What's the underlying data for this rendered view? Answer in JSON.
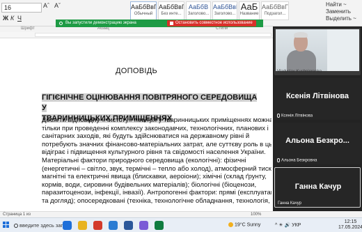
{
  "ribbon": {
    "font_name": "",
    "font_size": "16",
    "format_buttons": [
      "Aˆ",
      "Aˇ"
    ],
    "bottom_labels": [
      "Ж",
      "К",
      "Ч"
    ],
    "styles": [
      {
        "sample": "АаБбВвГг,",
        "name": "Обычный"
      },
      {
        "sample": "АаБбВвГг,",
        "name": "Без инте..."
      },
      {
        "sample": "АаБбВ",
        "name": "Заголово..."
      },
      {
        "sample": "АаБбВвГ",
        "name": "Заголово..."
      },
      {
        "sample": "АаБ",
        "name": "Название"
      },
      {
        "sample": "АаБбВвГг",
        "name": "Подзагол..."
      }
    ],
    "right_items": [
      "Найти ~",
      "Заменить",
      "Выделить ~"
    ],
    "group_labels": [
      "Шрифт",
      "Абзац",
      "Стили"
    ]
  },
  "banner": {
    "demo_text": "Вы запустили демонстрацию экрана",
    "stop_text": "Остановить совместное использование",
    "color": "#1e9b45",
    "stop_color": "#d9302a"
  },
  "document": {
    "title": "ДОПОВІДЬ",
    "heading": [
      "ГІГІЄНІЧНЕ ОЦІНЮВАННЯ ПОВІТРЯНОГО СЕРЕДОВИЩА У",
      "ТВАРИННИЦЬКИХ ПРИМІЩЕННЯХ"
    ],
    "lines": [
      "Досягти відповідну «чистоту» повітря у тваринницьких приміщеннях можна",
      "тільки при проведенні комплексу законодавчих, технологічних, планових і",
      "санітарних заходів, які будуть здійснюватися на державному рівні й",
      "потребують значних фінансово-матеріальних затрат, але суттєву роль в цьому",
      "відіграє і підвищення культурного рівня та свідомості населення України.",
      "Матеріальні фактори природного середовища (екологічні): фізичні",
      "(енергетичні – світло, звук, термічні – тепло або холод), атмосферний тиск,",
      "магнітні та електричні явища (блискавки, аероіони); хімічні (склад ґрунту,",
      "кормів, води, сировини будівельних матеріалів); біологічні (біоценози,",
      "паразитоценози, інфекції, інвазії). Антропогенні фактори: прямі (експлуатація",
      "та догляд); опосередковані (техніка, технологічне обладнання, технологія,"
    ]
  },
  "status": {
    "left": "Страница 1 из",
    "zoom": "100%"
  },
  "participants": [
    {
      "name_big": "",
      "label": "Vladyslav Kushnierenko",
      "video": true
    },
    {
      "name_big": "Ксенія Літвінова",
      "label": "Ксенія Літвінова",
      "video": false
    },
    {
      "name_big": "Альона Безкро...",
      "label": "Альона Безкровна",
      "video": false
    },
    {
      "name_big": "Ганна Качур",
      "label": "Ганна Качур",
      "video": false
    }
  ],
  "taskbar": {
    "search_text": "ввeдите здесь запрос",
    "weather": "19°C  Sunny",
    "lang": "УКР",
    "time": "12:15",
    "date": "17.05.2024",
    "icon_colors": [
      "#1e6fd9",
      "#e8b321",
      "#d33a2c",
      "#2b7cd3",
      "#2b579a",
      "#7b5cd6",
      "#0f7b3f"
    ]
  }
}
